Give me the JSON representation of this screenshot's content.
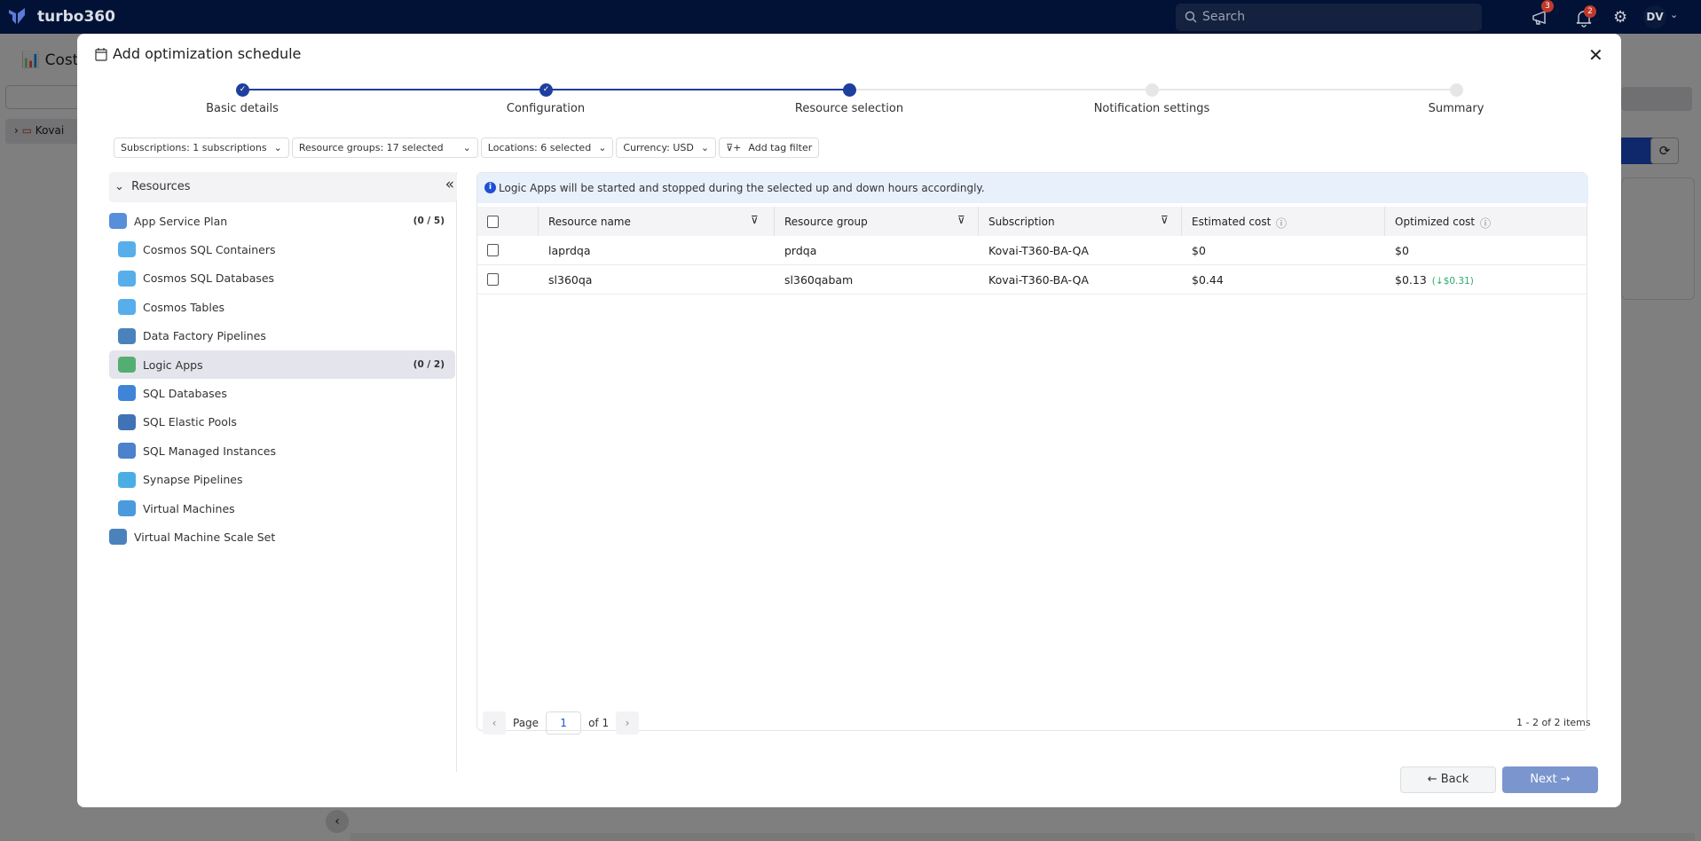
{
  "topbar": {
    "brand": "turbo360",
    "search_placeholder": "Search",
    "announcements_badge": "3",
    "notifications_badge": "2",
    "user_initials": "DV"
  },
  "background": {
    "page_title": "Cost An",
    "tree_item": "Kovai"
  },
  "modal": {
    "title": "Add optimization schedule",
    "steps": [
      {
        "label": "Basic details",
        "state": "completed"
      },
      {
        "label": "Configuration",
        "state": "completed"
      },
      {
        "label": "Resource selection",
        "state": "current"
      },
      {
        "label": "Notification settings",
        "state": "pending"
      },
      {
        "label": "Summary",
        "state": "pending"
      }
    ],
    "filters": {
      "subscriptions": "Subscriptions: 1 subscriptions",
      "resource_groups": "Resource groups: 17 selected",
      "locations": "Locations: 6 selected",
      "currency": "Currency: USD",
      "add_tag": "Add tag filter"
    },
    "resources": {
      "header": "Resources",
      "items": [
        {
          "label": "App Service Plan",
          "count": "(0 / 5)",
          "level": 0,
          "icon": "app-service-plan-icon"
        },
        {
          "label": "Cosmos SQL Containers",
          "level": 1,
          "icon": "cosmos-db-icon"
        },
        {
          "label": "Cosmos SQL Databases",
          "level": 1,
          "icon": "cosmos-db-icon"
        },
        {
          "label": "Cosmos Tables",
          "level": 1,
          "icon": "cosmos-db-icon"
        },
        {
          "label": "Data Factory Pipelines",
          "level": 1,
          "icon": "data-factory-icon"
        },
        {
          "label": "Logic Apps",
          "count": "(0 / 2)",
          "level": 1,
          "icon": "logic-apps-icon",
          "selected": true
        },
        {
          "label": "SQL Databases",
          "level": 1,
          "icon": "sql-database-icon"
        },
        {
          "label": "SQL Elastic Pools",
          "level": 1,
          "icon": "sql-elastic-pool-icon"
        },
        {
          "label": "SQL Managed Instances",
          "level": 1,
          "icon": "sql-managed-instance-icon"
        },
        {
          "label": "Synapse Pipelines",
          "level": 1,
          "icon": "synapse-icon"
        },
        {
          "label": "Virtual Machines",
          "level": 1,
          "icon": "virtual-machine-icon"
        },
        {
          "label": "Virtual Machine Scale Set",
          "level": 0,
          "icon": "vm-scale-set-icon"
        }
      ]
    },
    "info_banner": "Logic Apps will be started and stopped during the selected up and down hours accordingly.",
    "table": {
      "columns": [
        "Resource name",
        "Resource group",
        "Subscription",
        "Estimated cost",
        "Optimized cost"
      ],
      "rows": [
        {
          "name": "laprdqa",
          "group": "prdqa",
          "subscription": "Kovai-T360-BA-QA",
          "estimated": "$0",
          "optimized": "$0",
          "savings": ""
        },
        {
          "name": "sl360qa",
          "group": "sl360qabam",
          "subscription": "Kovai-T360-BA-QA",
          "estimated": "$0.44",
          "optimized": "$0.13",
          "savings": "(↓$0.31)"
        }
      ]
    },
    "pagination": {
      "page_label": "Page",
      "page": "1",
      "of_label": "of 1",
      "count": "1 - 2 of 2 items"
    },
    "back_label": "Back",
    "next_label": "Next"
  },
  "colors": {
    "topbar": "#021236",
    "accent": "#1e4fd6",
    "step_done": "#1e3f9e",
    "next_disabled": "#7b96cf",
    "savings": "#2ea86a"
  }
}
